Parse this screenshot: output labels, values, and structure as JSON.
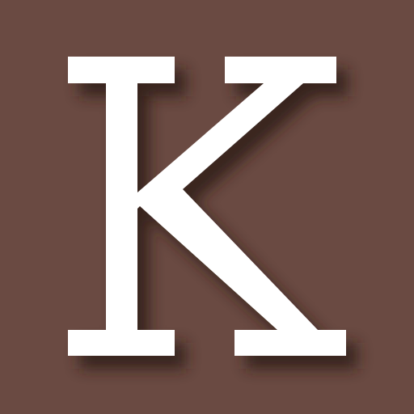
{
  "tile": {
    "letter": "K",
    "background_color": "#6A4A42",
    "letter_color": "#FFFFFF",
    "shadow_color": "#2E1A15"
  }
}
